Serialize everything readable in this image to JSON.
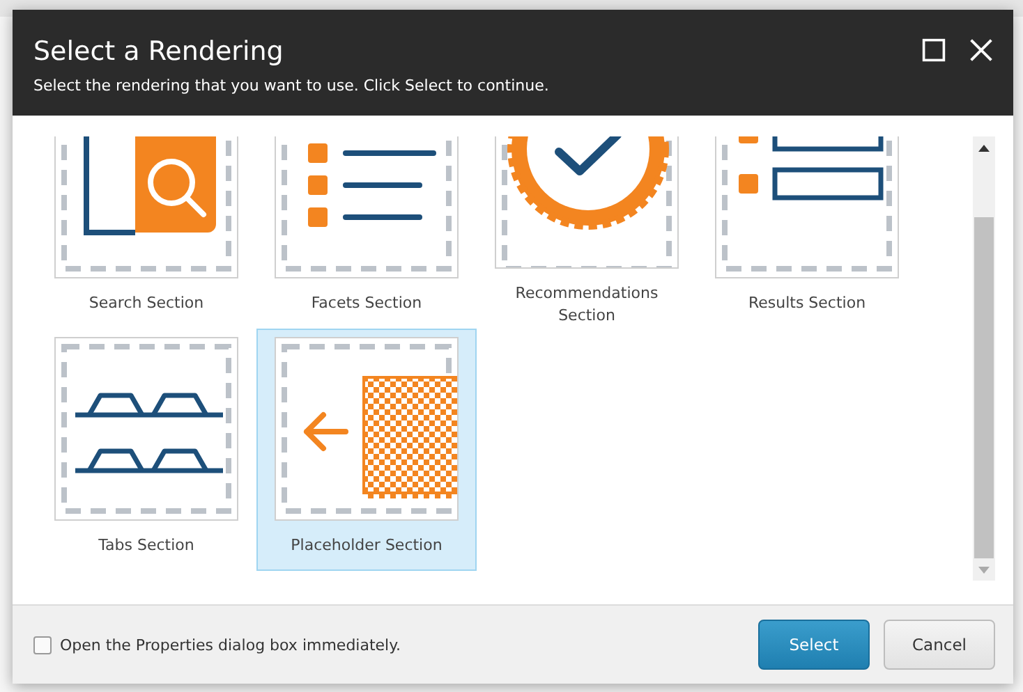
{
  "dialog": {
    "title": "Select a Rendering",
    "subtitle": "Select the rendering that you want to use. Click Select to continue.",
    "renderings": [
      {
        "label": "Search Section",
        "kind": "search",
        "selected": false
      },
      {
        "label": "Facets Section",
        "kind": "facets",
        "selected": false
      },
      {
        "label": "Recommendations Section",
        "kind": "recommendations",
        "selected": false
      },
      {
        "label": "Results Section",
        "kind": "results",
        "selected": false
      },
      {
        "label": "Tabs Section",
        "kind": "tabs",
        "selected": false
      },
      {
        "label": "Placeholder Section",
        "kind": "placeholder",
        "selected": true
      }
    ],
    "open_properties": {
      "label": "Open the Properties dialog box immediately.",
      "checked": false
    },
    "buttons": [
      {
        "label": "Select",
        "kind": "primary"
      },
      {
        "label": "Cancel",
        "kind": "secondary"
      }
    ]
  }
}
